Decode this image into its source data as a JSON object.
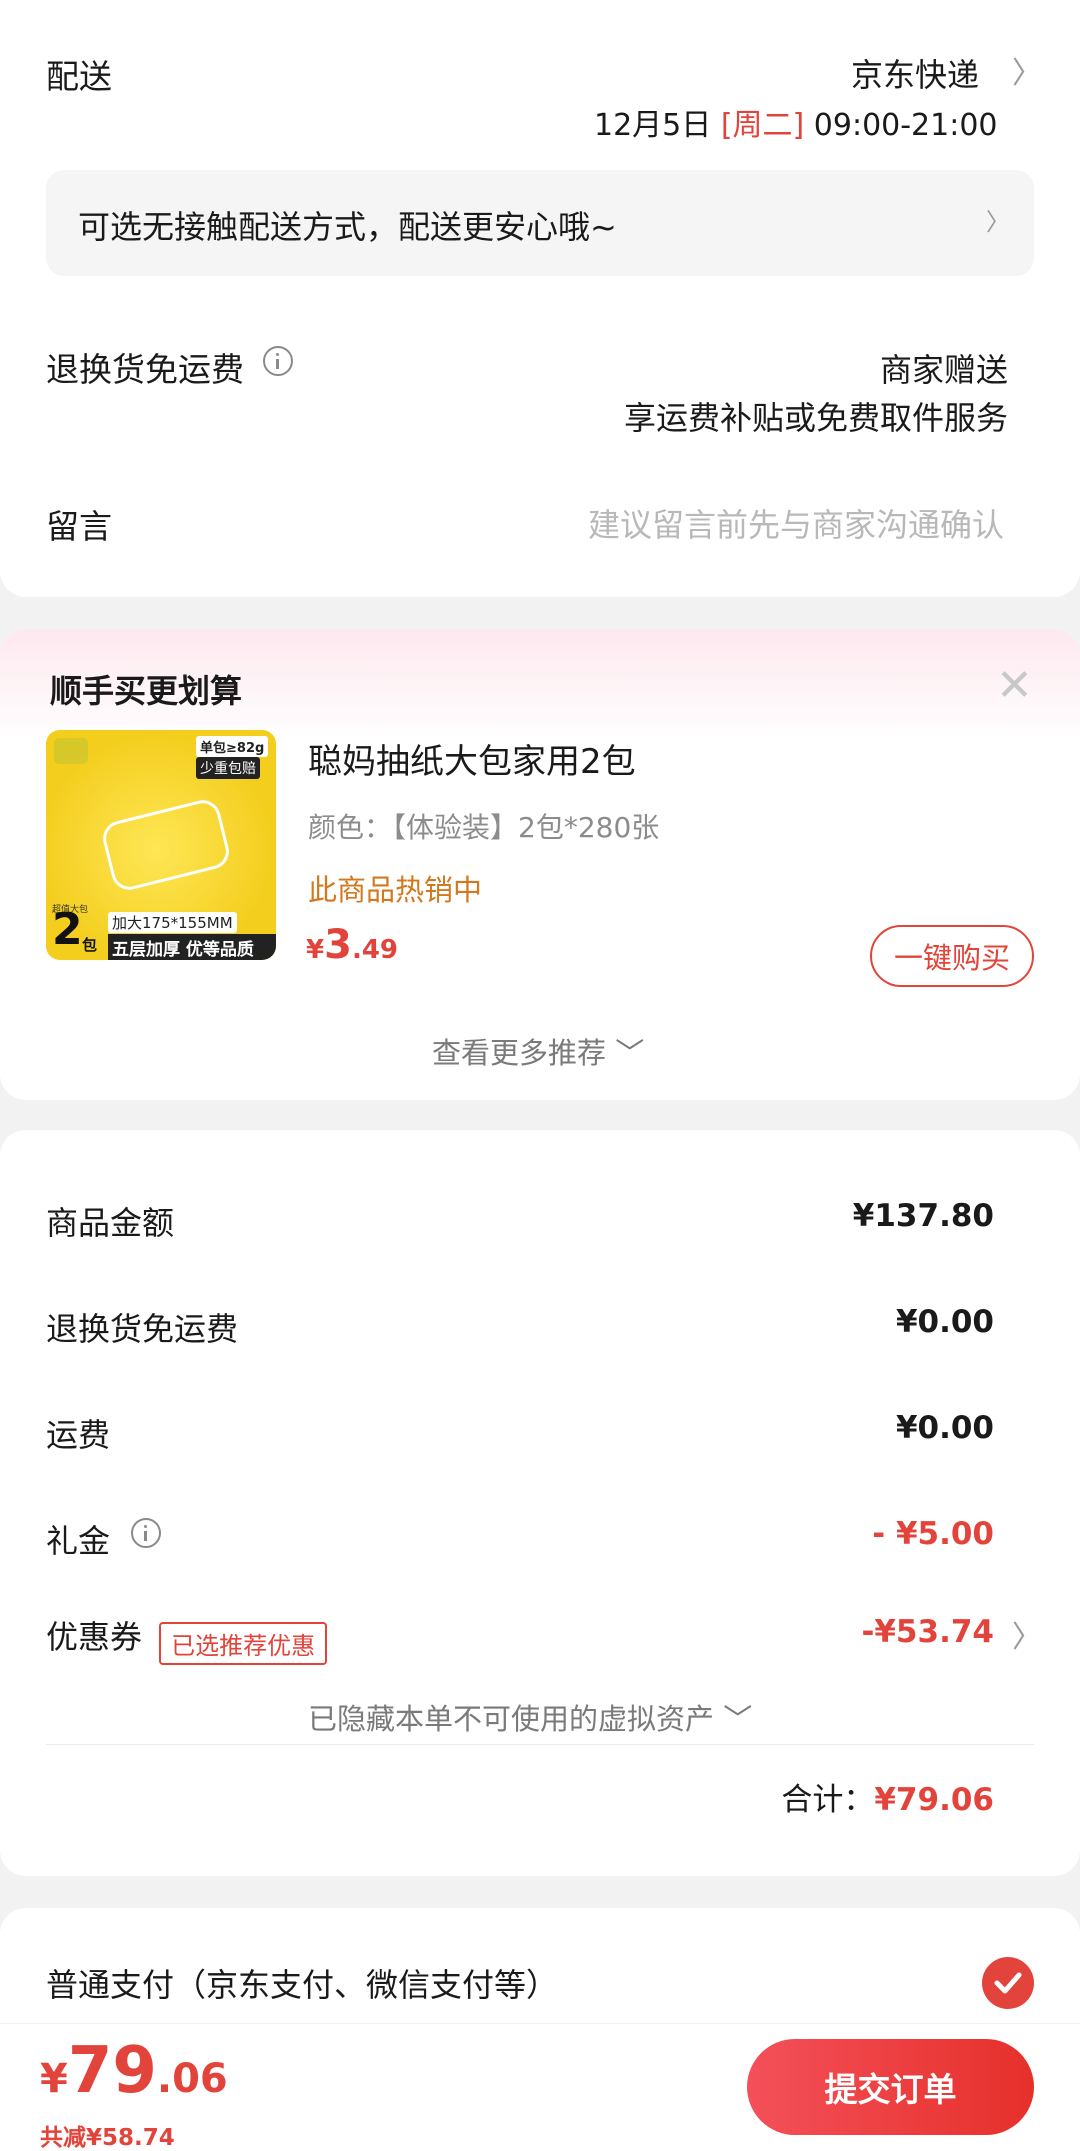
{
  "delivery": {
    "label": "配送",
    "carrier": "京东快递",
    "date": "12月5日",
    "weekday": "[周二]",
    "time": "09:00-21:00",
    "notice": "可选无接触配送方式，配送更安心哦~"
  },
  "return_shipping": {
    "label": "退换货免运费",
    "line1": "商家赠送",
    "line2": "享运费补贴或免费取件服务"
  },
  "message": {
    "label": "留言",
    "placeholder": "建议留言前先与商家沟通确认"
  },
  "recommend": {
    "title": "顺手买更划算",
    "product": {
      "name": "聪妈抽纸大包家用2包",
      "spec": "颜色：【体验装】2包*280张",
      "hot": "此商品热销中",
      "price_symbol": "¥",
      "price_int": "3",
      "price_dec": ".49",
      "image_badge_top": "单包≥82g",
      "image_badge_sub": "少重包赔",
      "image_size": "加大175*155MM",
      "image_bottom": "五层加厚 优等品质",
      "image_pack_num": "2",
      "image_pack_unit": "包",
      "image_pack_label": "超值大包"
    },
    "buy_button": "一键购买",
    "more": "查看更多推荐"
  },
  "summary": {
    "rows": [
      {
        "label": "商品金额",
        "value": "¥137.80"
      },
      {
        "label": "退换货免运费",
        "value": "¥0.00"
      },
      {
        "label": "运费",
        "value": "¥0.00"
      },
      {
        "label": "礼金",
        "value": "- ¥5.00"
      },
      {
        "label": "优惠券",
        "value": "-¥53.74"
      }
    ],
    "coupon_tag": "已选推荐优惠",
    "hidden_assets": "已隐藏本单不可使用的虚拟资产",
    "total_label": "合计：",
    "total_value": "¥79.06"
  },
  "payment": {
    "method": "普通支付（京东支付、微信支付等）"
  },
  "bottom": {
    "symbol": "¥",
    "int": "79",
    "dec": ".06",
    "saved": "共减¥58.74",
    "submit": "提交订单"
  },
  "colors": {
    "accent": "#e2443b",
    "hot": "#d4781e"
  }
}
